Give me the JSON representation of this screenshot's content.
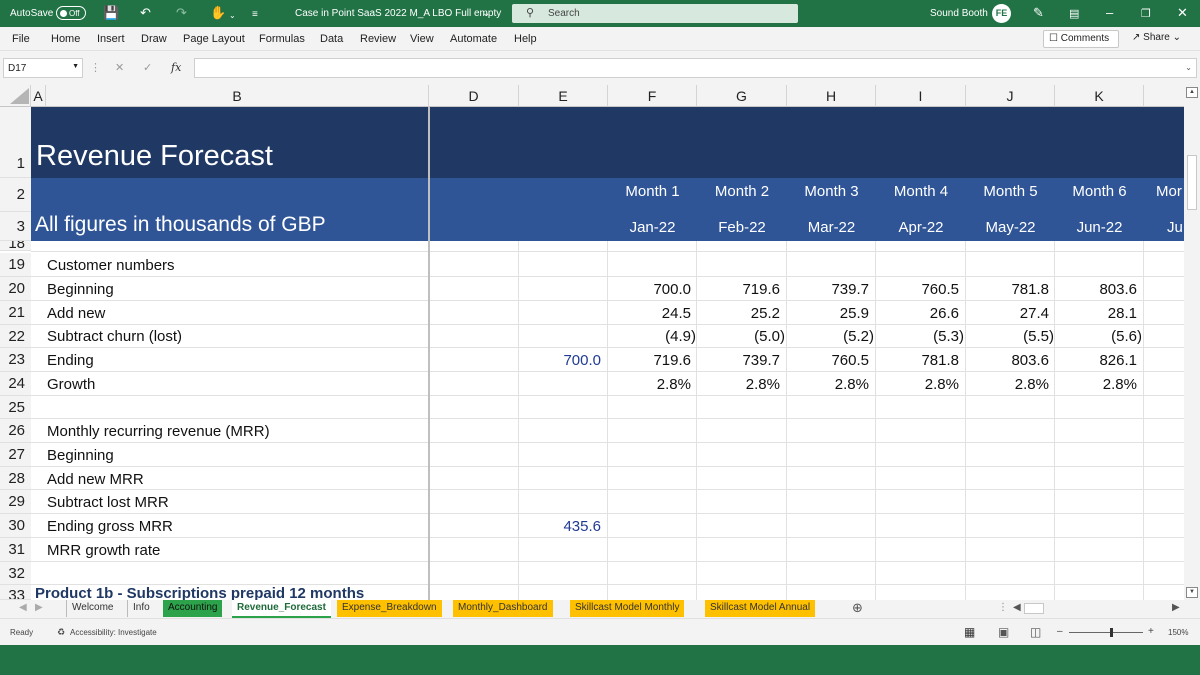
{
  "titlebar": {
    "autosave_label": "AutoSave",
    "autosave_state": "Off",
    "document_title": "Case in Point SaaS 2022 M_A LBO Full empty",
    "search_placeholder": "Search",
    "user_name": "Sound Booth",
    "avatar_initials": "FE"
  },
  "menu": {
    "items": [
      "File",
      "Home",
      "Insert",
      "Draw",
      "Page Layout",
      "Formulas",
      "Data",
      "Review",
      "View",
      "Automate",
      "Help"
    ],
    "comments_label": "Comments",
    "share_label": "Share"
  },
  "formula_bar": {
    "name_box": "D17",
    "fx_label": "fx",
    "formula": ""
  },
  "columns": [
    "A",
    "B",
    "D",
    "E",
    "F",
    "G",
    "H",
    "I",
    "J",
    "K"
  ],
  "rows": {
    "r1": "1",
    "r2": "2",
    "r3": "3",
    "r18": "18",
    "r19": "19",
    "r20": "20",
    "r21": "21",
    "r22": "22",
    "r23": "23",
    "r24": "24",
    "r25": "25",
    "r26": "26",
    "r27": "27",
    "r28": "28",
    "r29": "29",
    "r30": "30",
    "r31": "31",
    "r32": "32",
    "r33": "33"
  },
  "header": {
    "title": "Revenue Forecast",
    "subtitle": "All figures in thousands of GBP",
    "months": [
      "Month 1",
      "Month 2",
      "Month 3",
      "Month 4",
      "Month 5",
      "Month 6",
      "Mor"
    ],
    "dates": [
      "Jan-22",
      "Feb-22",
      "Mar-22",
      "Apr-22",
      "May-22",
      "Jun-22",
      "Ju"
    ]
  },
  "sheet": {
    "customer_numbers": "Customer numbers",
    "beginning": {
      "label": "Beginning",
      "values": [
        "700.0",
        "719.6",
        "739.7",
        "760.5",
        "781.8",
        "803.6"
      ]
    },
    "add_new": {
      "label": "Add new",
      "values": [
        "24.5",
        "25.2",
        "25.9",
        "26.6",
        "27.4",
        "28.1"
      ]
    },
    "churn": {
      "label": "Subtract churn (lost)",
      "values": [
        "(4.9)",
        "(5.0)",
        "(5.2)",
        "(5.3)",
        "(5.5)",
        "(5.6)"
      ]
    },
    "ending": {
      "label": "Ending",
      "e_value": "700.0",
      "values": [
        "719.6",
        "739.7",
        "760.5",
        "781.8",
        "803.6",
        "826.1"
      ]
    },
    "growth": {
      "label": "Growth",
      "values": [
        "2.8%",
        "2.8%",
        "2.8%",
        "2.8%",
        "2.8%",
        "2.8%"
      ]
    },
    "mrr_heading": "Monthly recurring revenue (MRR)",
    "mrr_beginning": "Beginning",
    "mrr_add_new": "Add new MRR",
    "mrr_subtract_lost": "Subtract lost MRR",
    "mrr_ending": {
      "label": "Ending gross MRR",
      "e_value": "435.6"
    },
    "mrr_growth": "MRR growth rate",
    "product_heading": "Product 1b - Subscriptions prepaid 12 months"
  },
  "tabs": {
    "welcome": "Welcome",
    "info": "Info",
    "accounting": "Accounting",
    "revenue_forecast": "Revenue_Forecast",
    "expense_breakdown": "Expense_Breakdown",
    "monthly_dashboard": "Monthly_Dashboard",
    "skillcast_monthly": "Skillcast Model Monthly",
    "skillcast_annual": "Skillcast Model Annual"
  },
  "status": {
    "ready": "Ready",
    "accessibility": "Accessibility: Investigate",
    "zoom": "150%"
  },
  "colors": {
    "excel_green": "#217346",
    "title_band": "#1f3864",
    "header_band": "#2f5597",
    "tab_green": "#2ca24a",
    "tab_orange": "#ffc000",
    "input_blue": "#1f3a93"
  }
}
